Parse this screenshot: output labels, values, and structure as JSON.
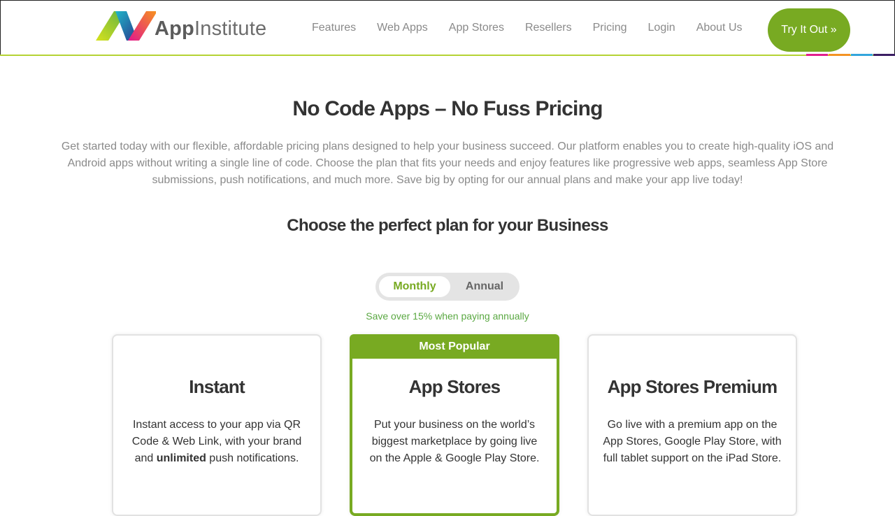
{
  "header": {
    "logo": {
      "brand_app": "App",
      "brand_rest": "Institute"
    },
    "nav": [
      "Features",
      "Web Apps",
      "App Stores",
      "Resellers",
      "Pricing",
      "Login",
      "About Us"
    ],
    "cta_label": "Try It Out »",
    "accent_colors": [
      "#e21e8c",
      "#f39323",
      "#33a5dc",
      "#3b1e63"
    ]
  },
  "hero": {
    "title": "No Code Apps – No Fuss Pricing",
    "description": "Get started today with our flexible, affordable pricing plans designed to help your business succeed. Our platform enables you to create high-quality iOS and Android apps without writing a single line of code. Choose the plan that fits your needs and enjoy features like progressive web apps, seamless App Store submissions, push notifications, and much more. Save big by opting for our annual plans and make your app live today!",
    "subtitle": "Choose the perfect plan for your Business"
  },
  "billing": {
    "monthly": "Monthly",
    "annual": "Annual",
    "selected": "Monthly",
    "save_note": "Save over 15% when paying annually"
  },
  "plans": [
    {
      "name": "Instant",
      "desc_before": "Instant access to your app via QR Code & Web Link, with your brand and ",
      "desc_bold": "unlimited",
      "desc_after": " push notifications."
    },
    {
      "badge": "Most Popular",
      "name": "App Stores",
      "desc_before": "Put your business on the world’s biggest marketplace by going live on the Apple & Google Play Store.",
      "desc_bold": "",
      "desc_after": ""
    },
    {
      "name": "App Stores Premium",
      "desc_before": "Go live with a premium app on the App Stores, Google Play Store, with full tablet support on the iPad Store.",
      "desc_bold": "",
      "desc_after": ""
    }
  ],
  "colors": {
    "brand_green": "#78aa22",
    "header_line": "#b5d334",
    "save_green": "#5aa842"
  }
}
